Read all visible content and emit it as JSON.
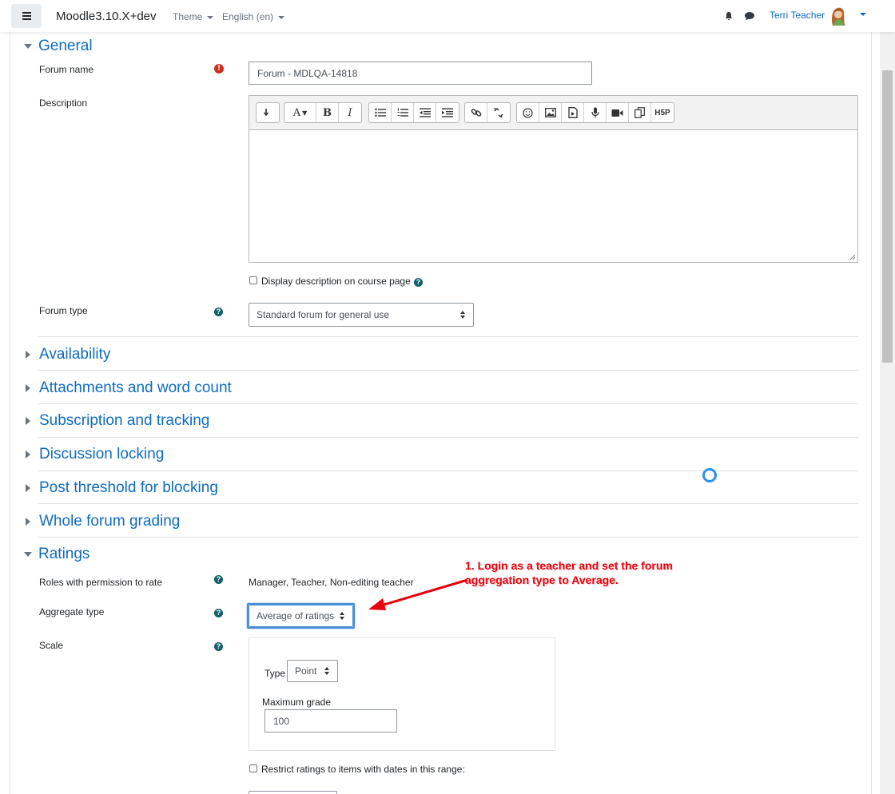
{
  "navbar": {
    "site_name": "Moodle3.10.X+dev",
    "theme_label": "Theme",
    "language_label": "English (en)",
    "user_name": "Terri Teacher"
  },
  "general": {
    "title": "General",
    "forum_name_label": "Forum name",
    "forum_name_value": "Forum - MDLQA-14818",
    "description_label": "Description",
    "display_description_label": "Display description on course page",
    "forum_type_label": "Forum type",
    "forum_type_value": "Standard forum for general use"
  },
  "collapsed_sections": [
    "Availability",
    "Attachments and word count",
    "Subscription and tracking",
    "Discussion locking",
    "Post threshold for blocking",
    "Whole forum grading"
  ],
  "ratings": {
    "title": "Ratings",
    "roles_label": "Roles with permission to rate",
    "roles_value": "Manager, Teacher, Non-editing teacher",
    "aggregate_label": "Aggregate type",
    "aggregate_value": "Average of ratings",
    "scale_label": "Scale",
    "type_label": "Type",
    "type_value": "Point",
    "max_grade_label": "Maximum grade",
    "max_grade_value": "100",
    "restrict_label": "Restrict ratings to items with dates in this range:"
  },
  "annotation": {
    "line1": "1. Login as a teacher and set the forum",
    "line2": "aggregation type to Average."
  },
  "colors": {
    "link_blue": "#0f6cbf",
    "annotation_red": "#e8000b",
    "help_teal": "#115f6a",
    "required_red": "#ca3120"
  }
}
